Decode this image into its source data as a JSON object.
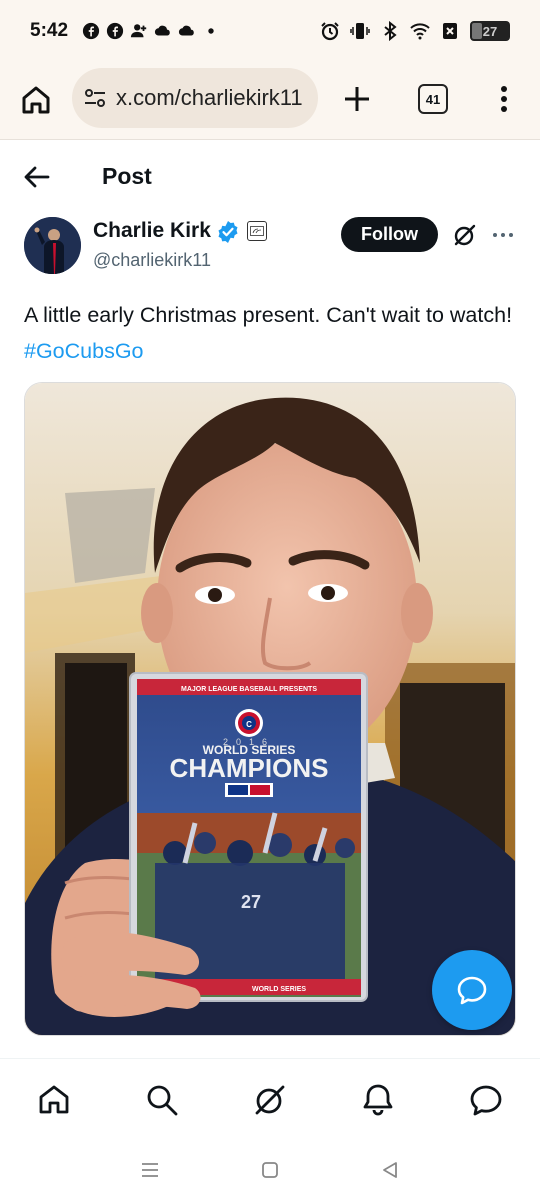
{
  "status_bar": {
    "time": "5:42",
    "battery_percent": 27,
    "battery_label": "27",
    "left_icons": [
      "facebook-icon",
      "facebook-icon",
      "person-add-icon",
      "cloud-icon",
      "cloud-icon",
      "dot-icon"
    ],
    "right_icons": [
      "alarm-icon",
      "vibrate-icon",
      "bluetooth-icon",
      "wifi-icon",
      "sim-icon",
      "battery-icon"
    ]
  },
  "browser": {
    "url": "x.com/charliekirk11",
    "tab_count": "41",
    "icons": [
      "home-icon",
      "tune-icon",
      "plus-icon",
      "tabs-icon",
      "more-vertical-icon"
    ]
  },
  "header": {
    "title": "Post",
    "back_icon": "arrow-left-icon"
  },
  "post": {
    "author_name": "Charlie Kirk",
    "handle": "@charliekirk11",
    "verified": true,
    "follow_label": "Follow",
    "text": "A little early Christmas present. Can't wait to watch! ",
    "hashtag": "#GoCubsGo",
    "media": {
      "dvd_top_label": "MAJOR LEAGUE BASEBALL PRESENTS",
      "dvd_year": "2016",
      "dvd_subtitle": "WORLD SERIES",
      "dvd_title": "CHAMPIONS",
      "dvd_player_number": "27",
      "dvd_bottom_label": "WORLD SERIES"
    }
  },
  "bottom_nav": {
    "items": [
      "home-icon",
      "search-icon",
      "grok-icon",
      "notifications-icon",
      "messages-icon"
    ]
  },
  "system_nav": {
    "items": [
      "recents-icon",
      "home-square-icon",
      "back-triangle-icon"
    ]
  },
  "colors": {
    "accent": "#1d9bf0",
    "text": "#0f1419",
    "secondary_text": "#536471",
    "browser_bg": "#fbf6f0"
  }
}
